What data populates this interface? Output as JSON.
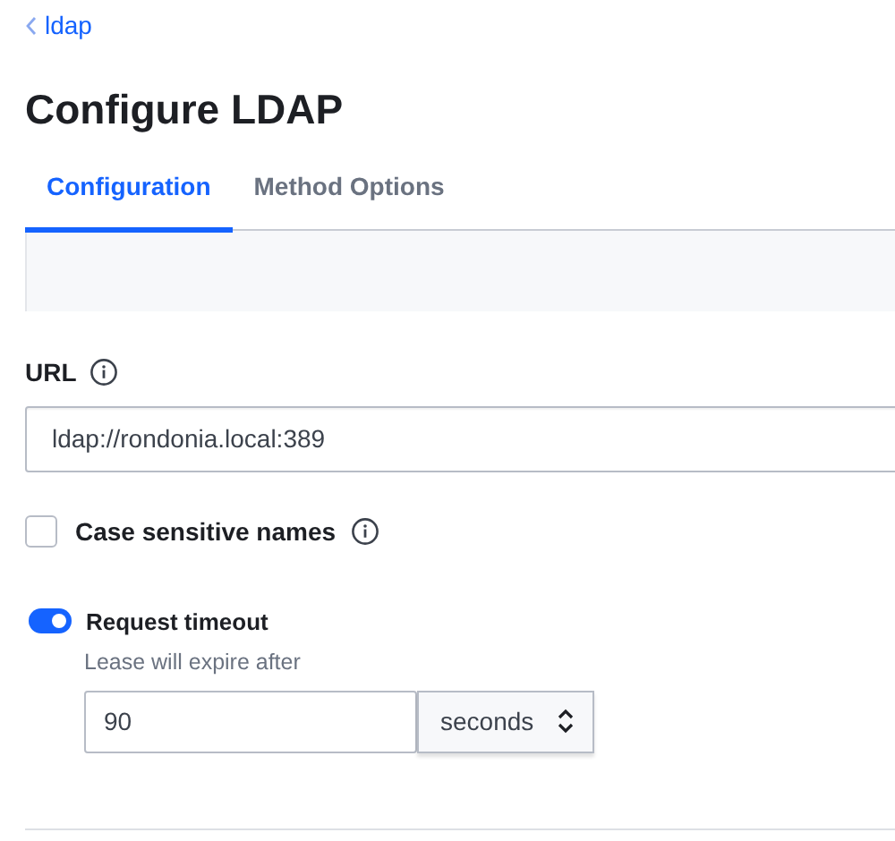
{
  "breadcrumb": {
    "label": "ldap"
  },
  "title": "Configure LDAP",
  "tabs": [
    {
      "label": "Configuration",
      "selected": true
    },
    {
      "label": "Method Options",
      "selected": false
    }
  ],
  "url_field": {
    "label": "URL",
    "value": "ldap://rondonia.local:389"
  },
  "case_sensitive": {
    "label": "Case sensitive names",
    "checked": false
  },
  "request_timeout": {
    "label": "Request timeout",
    "on": true,
    "help": "Lease will expire after",
    "value": "90",
    "unit": "seconds"
  }
}
